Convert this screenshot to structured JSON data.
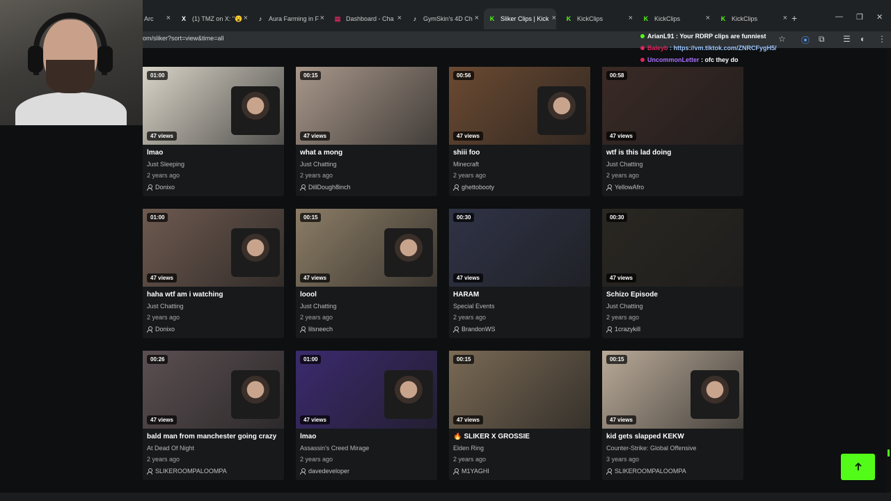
{
  "browser": {
    "tabs": [
      {
        "label": "Arc",
        "icon": "generic-tab-icon"
      },
      {
        "label": "(1) TMZ on X: \"😮",
        "icon": "x-icon"
      },
      {
        "label": "Aura Farming in F",
        "icon": "tiktok-icon"
      },
      {
        "label": "Dashboard - Cha",
        "icon": "dashboard-icon"
      },
      {
        "label": "GymSkin's 4D Ch",
        "icon": "tiktok-icon"
      },
      {
        "label": "Sliker Clips | Kick",
        "icon": "kick-icon",
        "active": true
      },
      {
        "label": "KickClips",
        "icon": "kick-icon"
      },
      {
        "label": "KickClips",
        "icon": "kick-icon"
      },
      {
        "label": "KickClips",
        "icon": "kick-icon"
      }
    ],
    "new_tab": "+",
    "close": "×",
    "url": "om/sliker?sort=view&time=all",
    "accent": "#53fc18"
  },
  "chat": [
    {
      "user": "ArianL91",
      "user_color": "#ffffff",
      "dot": "#53fc18",
      "message": " : Your RDRP clips are funniest",
      "msg_color": "#ffffff"
    },
    {
      "user": "Baleyb",
      "user_color": "#e0245e",
      "dot": "#e0245e",
      "message": " : https://vm.tiktok.com/ZNRCFygH5/",
      "msg_color": "#9ec8ff"
    },
    {
      "user": "UncommonLetter",
      "user_color": "#a970ff",
      "dot": "#e0245e",
      "message": " : ofc they do",
      "msg_color": "#ffffff"
    }
  ],
  "clips": [
    {
      "duration": "01:00",
      "views": "47 views",
      "title": "lmao",
      "category": "Just Sleeping",
      "age": "2 years ago",
      "user": "Donixo",
      "bg": "#d9d4c8",
      "cam": true
    },
    {
      "duration": "00:15",
      "views": "47 views",
      "title": "what a mong",
      "category": "Just Chatting",
      "age": "2 years ago",
      "user": "DillDough8inch",
      "bg": "#a8978a",
      "cam": false
    },
    {
      "duration": "00:56",
      "views": "47 views",
      "title": "shiii foo",
      "category": "Minecraft",
      "age": "2 years ago",
      "user": "ghettobooty",
      "bg": "#6b4a32",
      "cam": true
    },
    {
      "duration": "00:58",
      "views": "47 views",
      "title": "wtf is this lad doing",
      "category": "Just Chatting",
      "age": "2 years ago",
      "user": "YellowAfro",
      "bg": "#3a2a26",
      "cam": false
    },
    {
      "duration": "01:00",
      "views": "47 views",
      "title": "haha wtf am i watching",
      "category": "Just Chatting",
      "age": "2 years ago",
      "user": "Donixo",
      "bg": "#6e5a50",
      "cam": true
    },
    {
      "duration": "00:15",
      "views": "47 views",
      "title": "loool",
      "category": "Just Chatting",
      "age": "2 years ago",
      "user": "lilsneech",
      "bg": "#8c7d66",
      "cam": true
    },
    {
      "duration": "00:30",
      "views": "47 views",
      "title": "HARAM",
      "category": "Special Events",
      "age": "2 years ago",
      "user": "BrandonWS",
      "bg": "#2f3346",
      "cam": false
    },
    {
      "duration": "00:30",
      "views": "47 views",
      "title": "Schizo Episode",
      "category": "Just Chatting",
      "age": "2 years ago",
      "user": "1crazykill",
      "bg": "#2a2722",
      "cam": false
    },
    {
      "duration": "00:26",
      "views": "47 views",
      "title": "bald man from manchester going crazy",
      "category": "At Dead Of Night",
      "age": "2 years ago",
      "user": "SLIKEROOMPALOOMPA",
      "bg": "#5b4f52",
      "cam": true
    },
    {
      "duration": "01:00",
      "views": "47 views",
      "title": "lmao",
      "category": "Assassin's Creed Mirage",
      "age": "2 years ago",
      "user": "davedeveloper",
      "bg": "#3b2a6e",
      "cam": true
    },
    {
      "duration": "00:15",
      "views": "47 views",
      "title": "SLIKER X GROSSIE",
      "title_emoji": "🔥",
      "category": "Elden Ring",
      "age": "2 years ago",
      "user": "M1YAGHI",
      "bg": "#7a6a55",
      "cam": false
    },
    {
      "duration": "00:15",
      "views": "47 views",
      "title": "kid gets slapped KEKW",
      "category": "Counter-Strike: Global Offensive",
      "age": "3 years ago",
      "user": "SLIKEROOMPALOOMPA",
      "bg": "#b9aa98",
      "cam": true
    }
  ]
}
